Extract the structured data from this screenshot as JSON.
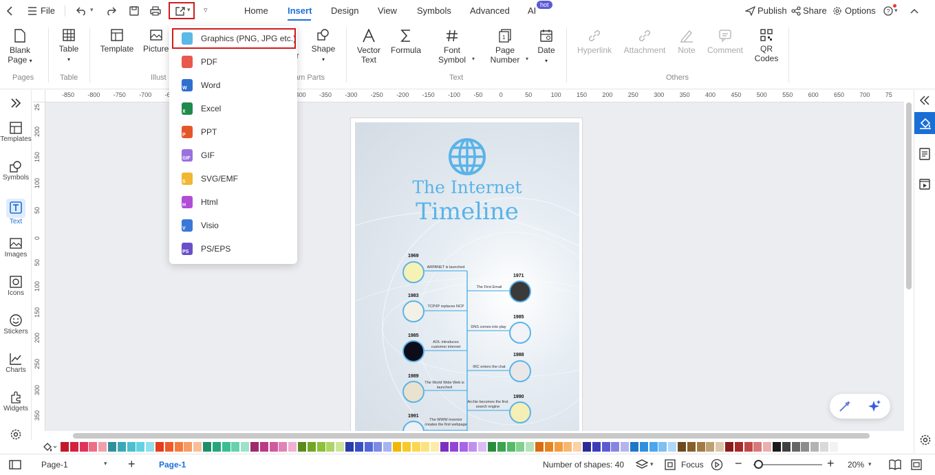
{
  "titlebar": {
    "file_label": "File",
    "tabs": [
      {
        "label": "Home"
      },
      {
        "label": "Insert"
      },
      {
        "label": "Design"
      },
      {
        "label": "View"
      },
      {
        "label": "Symbols"
      },
      {
        "label": "Advanced"
      },
      {
        "label": "AI"
      }
    ],
    "ai_badge": "hot",
    "publish_label": "Publish",
    "share_label": "Share",
    "options_label": "Options"
  },
  "ribbon": {
    "blank_page": [
      "Blank",
      "Page"
    ],
    "table": "Table",
    "template": "Template",
    "picture": "Picture",
    "picture_partial_right": "er",
    "shape": "Shape",
    "vector_text": [
      "Vector",
      "Text"
    ],
    "formula": "Formula",
    "font_symbol": [
      "Font",
      "Symbol"
    ],
    "page_number": [
      "Page",
      "Number"
    ],
    "date": "Date",
    "hyperlink": "Hyperlink",
    "attachment": "Attachment",
    "note": "Note",
    "comment": "Comment",
    "qr_codes": [
      "QR",
      "Codes"
    ],
    "groups": {
      "pages": "Pages",
      "table": "Table",
      "illust": "Illust",
      "diagram_parts": "am Parts",
      "text": "Text",
      "others": "Others"
    }
  },
  "export_menu": {
    "items": [
      {
        "label": "Graphics (PNG, JPG etc.)",
        "icon": "image-file-icon",
        "color": "#5cb8e6",
        "letter": ""
      },
      {
        "label": "PDF",
        "icon": "pdf-file-icon",
        "color": "#e8584d",
        "letter": ""
      },
      {
        "label": "Word",
        "icon": "word-file-icon",
        "color": "#2f6fd0",
        "letter": "W"
      },
      {
        "label": "Excel",
        "icon": "excel-file-icon",
        "color": "#1f8a4c",
        "letter": "X"
      },
      {
        "label": "PPT",
        "icon": "ppt-file-icon",
        "color": "#e5562a",
        "letter": "P"
      },
      {
        "label": "GIF",
        "icon": "gif-file-icon",
        "color": "#9a6fe0",
        "letter": "GIF"
      },
      {
        "label": "SVG/EMF",
        "icon": "svg-file-icon",
        "color": "#f2b632",
        "letter": "S"
      },
      {
        "label": "Html",
        "icon": "html-file-icon",
        "color": "#b04cd6",
        "letter": "H"
      },
      {
        "label": "Visio",
        "icon": "visio-file-icon",
        "color": "#3a78d8",
        "letter": "V"
      },
      {
        "label": "PS/EPS",
        "icon": "ps-file-icon",
        "color": "#6a4fc9",
        "letter": "PS"
      }
    ]
  },
  "leftbar": {
    "items": [
      {
        "label": "Templates",
        "icon": "templates-icon"
      },
      {
        "label": "Symbols",
        "icon": "symbols-icon"
      },
      {
        "label": "Text",
        "icon": "text-icon"
      },
      {
        "label": "Images",
        "icon": "images-icon"
      },
      {
        "label": "Icons",
        "icon": "icons-icon"
      },
      {
        "label": "Stickers",
        "icon": "stickers-icon"
      },
      {
        "label": "Charts",
        "icon": "charts-icon"
      },
      {
        "label": "Widgets",
        "icon": "widgets-icon"
      }
    ]
  },
  "ruler": {
    "h_ticks": [
      "-850",
      "-800",
      "-750",
      "-700",
      "-650",
      "-600",
      "-550",
      "-500",
      "-450",
      "-400",
      "-350",
      "-300",
      "-250",
      "-200",
      "-150",
      "-100",
      "-50",
      "0",
      "50",
      "100",
      "150",
      "200",
      "250",
      "300",
      "350",
      "400",
      "450",
      "500",
      "550",
      "600",
      "650",
      "700",
      "75"
    ],
    "v_ticks": [
      "25",
      "200",
      "150",
      "100",
      "50",
      "0",
      "50",
      "100",
      "150",
      "200",
      "250",
      "300",
      "350"
    ]
  },
  "poster": {
    "title_line1": "The Internet",
    "title_line2": "Timeline",
    "events": [
      {
        "year": "1969",
        "text": "ARPANET is launched"
      },
      {
        "year": "1971",
        "text": "The First Email"
      },
      {
        "year": "1983",
        "text": "TCP/IP replaces NCP"
      },
      {
        "year": "1985",
        "text": "DNS comes into play"
      },
      {
        "year": "1985",
        "text": "AOL introduces customer internet"
      },
      {
        "year": "1988",
        "text": "IRC enters the chat"
      },
      {
        "year": "1989",
        "text": "The World Wide Web is launched"
      },
      {
        "year": "1990",
        "text": "Archie becomes the first search engine"
      },
      {
        "year": "1991",
        "text": "The WWW inventor creates the first webpage"
      }
    ]
  },
  "palette": {
    "colors": [
      "#c0182a",
      "#d4213d",
      "#e0335a",
      "#ec6f86",
      "#f0a0ad",
      "#2e8f9a",
      "#3aa7b5",
      "#4bbfd0",
      "#63d2e0",
      "#8ee0ea",
      "#e43d1e",
      "#ef5a2b",
      "#f47b3d",
      "#f79b64",
      "#f9be97",
      "#1d8f6a",
      "#27a67d",
      "#3bbd94",
      "#66d1ad",
      "#9be2c9",
      "#9c2b6b",
      "#b93a84",
      "#cf5a9d",
      "#e283b8",
      "#f0b1d1",
      "#5a8a1d",
      "#73a626",
      "#8fc03a",
      "#add565",
      "#cde59a",
      "#2a3da8",
      "#3950c4",
      "#5467d8",
      "#7c8be4",
      "#a9b4ee",
      "#f2b705",
      "#f7c92a",
      "#fbd650",
      "#fde17d",
      "#fdebaa",
      "#7b2fbf",
      "#9145d6",
      "#a764e6",
      "#c18fef",
      "#dbbdf6",
      "#2a8a3e",
      "#3aa44f",
      "#56bb68",
      "#83d08f",
      "#b4e3bb",
      "#d86d12",
      "#e8841f",
      "#f29b3f",
      "#f7b76f",
      "#fad2a4",
      "#2b2b9c",
      "#3d3dba",
      "#5b5bd2",
      "#8686e0",
      "#b5b5ee",
      "#1e78c8",
      "#2e8fe0",
      "#4aa6ee",
      "#7cc0f4",
      "#b0d9f9",
      "#6b4a1e",
      "#86602a",
      "#a07b44",
      "#bfa072",
      "#dcc8a8",
      "#8b1c1c",
      "#a52a2a",
      "#c04848",
      "#d87878",
      "#ecaeae",
      "#1a1a1a",
      "#404040",
      "#666666",
      "#8c8c8c",
      "#b3b3b3",
      "#d9d9d9",
      "#f2f2f2"
    ]
  },
  "statusbar": {
    "page_select": "Page-1",
    "page_tab": "Page-1",
    "shapes_count": "Number of shapes: 40",
    "focus_label": "Focus",
    "zoom": "20%"
  }
}
